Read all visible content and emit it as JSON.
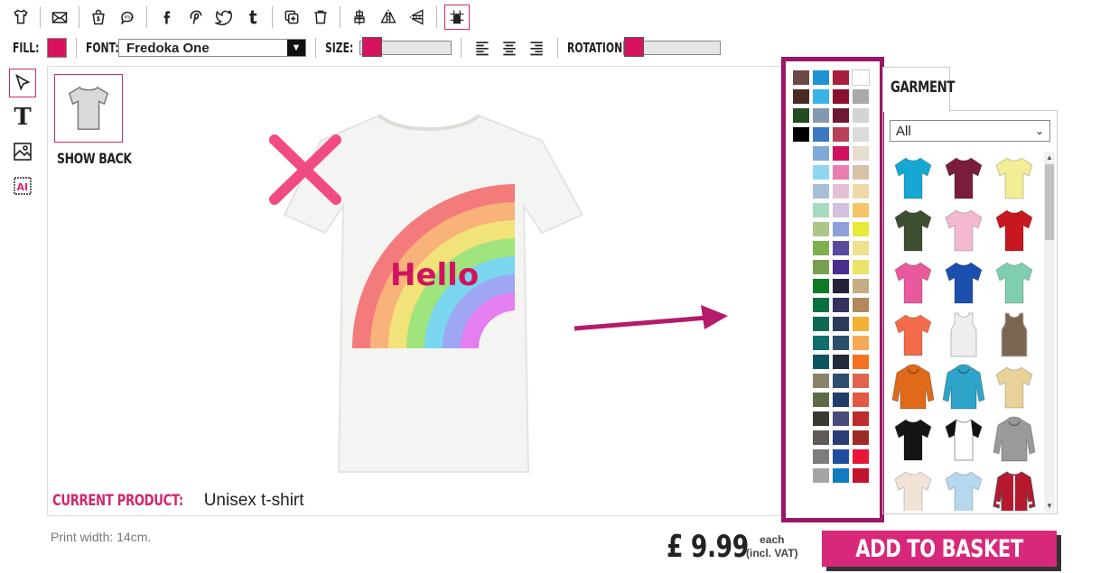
{
  "toolbar": {
    "icons": [
      "tshirt-icon",
      "email-icon",
      "shopify-icon",
      "etsy-icon",
      "facebook-icon",
      "pinterest-icon",
      "twitter-icon",
      "tumblr-icon",
      "duplicate-icon",
      "delete-icon",
      "align-center-vertical-icon",
      "flip-horizontal-icon",
      "flip-vertical-icon",
      "grid-snap-icon"
    ]
  },
  "props": {
    "fill_label": "FILL:",
    "fill_color": "#d7135f",
    "font_label": "FONT:",
    "font_value": "Fredoka One",
    "size_label": "SIZE:",
    "size_level": 0.0,
    "rotation_label": "ROTATION:",
    "rotation_level": 0.0
  },
  "design": {
    "show_back": "SHOW BACK",
    "text": "Hello",
    "current_product_label": "CURRENT PRODUCT:",
    "current_product_value": "Unisex t-shirt",
    "print_width": "Print width: 14cm."
  },
  "palette": {
    "col1": [
      "#6b4a47",
      "#4a2a25",
      "#244a20",
      "#000000"
    ],
    "col2": [
      "#1e93d4",
      "#39b4e8",
      "#8399b0",
      "#3a78c2",
      "#7fa9d8",
      "#8fd7f0",
      "#a7bfd4",
      "#a6dbbf",
      "#acc68a",
      "#7eb052",
      "#78a04e",
      "#0e7a23",
      "#0b7040",
      "#0c6a52",
      "#0c6f6a",
      "#0c555e",
      "#898469",
      "#5d6a47",
      "#3a3a31",
      "#5f5a55",
      "#7c7c7c",
      "#a5a5a5"
    ],
    "col3": [
      "#a81f3d",
      "#8b1030",
      "#6e1838",
      "#b8405a",
      "#d1135f",
      "#ea7db0",
      "#e6bfd6",
      "#d4c0dc",
      "#8fa0d9",
      "#5a4a9e",
      "#4a2e8e",
      "#24213b",
      "#34325e",
      "#2c3b5c",
      "#2d4f6a",
      "#232a3a",
      "#2c4f6f",
      "#1f3f6a",
      "#4a4a7a",
      "#2b3d78",
      "#1f4ea0",
      "#127cc0"
    ],
    "col4": [
      "#ffffff",
      "#a9a9a9",
      "#d4d4d4",
      "#dcdcdc",
      "#e6dcd0",
      "#d7c1a7",
      "#f0d9a6",
      "#f5c466",
      "#e9e93b",
      "#efe28c",
      "#ede36a",
      "#c7ad83",
      "#b08a5c",
      "#f5b134",
      "#f7a95a",
      "#f4721f",
      "#e1654e",
      "#e25a44",
      "#bf2a2a",
      "#9e2a25",
      "#e8173a",
      "#c4122f"
    ]
  },
  "garment": {
    "tab": "GARMENT",
    "filter": "All",
    "items": [
      {
        "name": "tshirt-cyan-icon",
        "color": "#16a7d4",
        "type": "tee"
      },
      {
        "name": "tshirt-maroon-icon",
        "color": "#7a1c3c",
        "type": "tee"
      },
      {
        "name": "tshirt-yellow-icon",
        "color": "#f1ee95",
        "type": "tee"
      },
      {
        "name": "tshirt-olive-icon",
        "color": "#3e4e30",
        "type": "tee"
      },
      {
        "name": "tshirt-pink-icon",
        "color": "#f2b9d0",
        "type": "tee"
      },
      {
        "name": "tshirt-red-icon",
        "color": "#c71820",
        "type": "tee"
      },
      {
        "name": "tshirt-hotpink-icon",
        "color": "#e85a9d",
        "type": "tee"
      },
      {
        "name": "tshirt-royal-icon",
        "color": "#1a4fae",
        "type": "tee"
      },
      {
        "name": "tshirt-mint-icon",
        "color": "#7fceb0",
        "type": "tee"
      },
      {
        "name": "tshirt-coral-icon",
        "color": "#f26b4a",
        "type": "tee"
      },
      {
        "name": "tank-white-icon",
        "color": "#eeeeee",
        "type": "tank"
      },
      {
        "name": "tank-brown-icon",
        "color": "#7a6650",
        "type": "tank"
      },
      {
        "name": "hoodie-orange-icon",
        "color": "#e06a1a",
        "type": "hoodie"
      },
      {
        "name": "hoodie-blue-icon",
        "color": "#2ea4c8",
        "type": "hoodie"
      },
      {
        "name": "tshirt-tiedye-icon",
        "color": "#e9d29a",
        "type": "tee"
      },
      {
        "name": "tshirt-black-icon",
        "color": "#151515",
        "type": "tee"
      },
      {
        "name": "raglan-black-white-icon",
        "color": "#111111",
        "type": "raglan"
      },
      {
        "name": "hoodie-grey-icon",
        "color": "#9a9a9a",
        "type": "hoodie"
      },
      {
        "name": "tshirt-natural-icon",
        "color": "#f1e3d6",
        "type": "tee"
      },
      {
        "name": "tshirt-lightblue-icon",
        "color": "#b5d8ef",
        "type": "tee"
      },
      {
        "name": "jacket-varsity-icon",
        "color": "#b8182e",
        "type": "jacket"
      }
    ]
  },
  "checkout": {
    "price": "£ 9.99",
    "each": "each",
    "vat": "(incl. VAT)",
    "basket_label": "ADD TO BASKET"
  }
}
